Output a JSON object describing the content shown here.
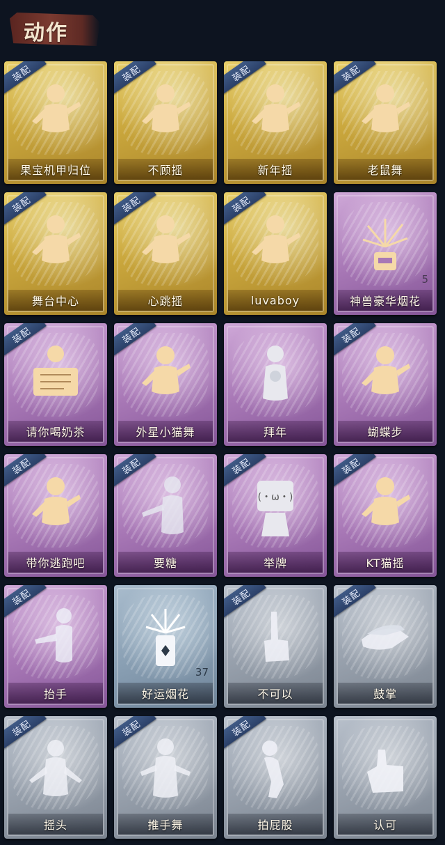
{
  "header": {
    "title": "动作"
  },
  "colors": {
    "gold": "#c9a63c",
    "purple": "#a878b6",
    "silver": "#97a0ac",
    "bluegray": "#8aa0b4",
    "badge": "#2b4068",
    "background": "#0d1420"
  },
  "badge_label": "装配",
  "items": [
    {
      "label": "果宝机甲归位",
      "rarity": "gold",
      "equipped": true,
      "icon": "dance-figure-icon"
    },
    {
      "label": "不顾摇",
      "rarity": "gold",
      "equipped": true,
      "icon": "dance-figure-icon"
    },
    {
      "label": "新年摇",
      "rarity": "gold",
      "equipped": true,
      "icon": "dance-figure-icon"
    },
    {
      "label": "老鼠舞",
      "rarity": "gold",
      "equipped": true,
      "icon": "dance-figure-icon"
    },
    {
      "label": "舞台中心",
      "rarity": "gold",
      "equipped": true,
      "icon": "dance-figure-icon"
    },
    {
      "label": "心跳摇",
      "rarity": "gold",
      "equipped": true,
      "icon": "dance-figure-icon"
    },
    {
      "label": "luvaboy",
      "rarity": "gold",
      "equipped": true,
      "icon": "dance-figure-icon"
    },
    {
      "label": "神兽豪华烟花",
      "rarity": "purple",
      "equipped": false,
      "count": "5",
      "icon": "firework-box-icon"
    },
    {
      "label": "请你喝奶茶",
      "rarity": "purple",
      "equipped": true,
      "icon": "figure-with-sign-icon"
    },
    {
      "label": "外星小猫舞",
      "rarity": "purple",
      "equipped": true,
      "icon": "dance-figure-icon"
    },
    {
      "label": "拜年",
      "rarity": "purple",
      "equipped": false,
      "icon": "bow-figure-icon"
    },
    {
      "label": "蝴蝶步",
      "rarity": "purple",
      "equipped": true,
      "icon": "dance-figure-icon"
    },
    {
      "label": "带你逃跑吧",
      "rarity": "purple",
      "equipped": true,
      "icon": "dance-figure-icon"
    },
    {
      "label": "要糖",
      "rarity": "purple",
      "equipped": true,
      "icon": "reach-figure-icon"
    },
    {
      "label": "举牌",
      "rarity": "purple",
      "equipped": true,
      "icon": "figure-holding-sign-icon"
    },
    {
      "label": "KT猫摇",
      "rarity": "purple",
      "equipped": true,
      "icon": "dance-figure-icon"
    },
    {
      "label": "抬手",
      "rarity": "purple",
      "equipped": true,
      "icon": "raise-hand-figure-icon"
    },
    {
      "label": "好运烟花",
      "rarity": "bluegray",
      "equipped": false,
      "count": "37",
      "icon": "firework-can-icon"
    },
    {
      "label": "不可以",
      "rarity": "silver",
      "equipped": true,
      "icon": "finger-wag-icon"
    },
    {
      "label": "鼓掌",
      "rarity": "silver",
      "equipped": true,
      "icon": "clapping-hands-icon"
    },
    {
      "label": "摇头",
      "rarity": "silver",
      "equipped": true,
      "icon": "shake-head-figure-icon"
    },
    {
      "label": "推手舞",
      "rarity": "silver",
      "equipped": true,
      "icon": "push-hands-figure-icon"
    },
    {
      "label": "拍屁股",
      "rarity": "silver",
      "equipped": true,
      "icon": "pat-figure-icon"
    },
    {
      "label": "认可",
      "rarity": "silver",
      "equipped": false,
      "icon": "thumbs-up-icon"
    }
  ]
}
